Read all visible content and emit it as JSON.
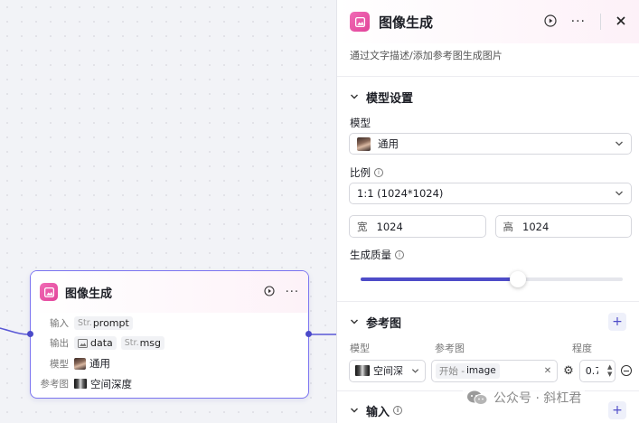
{
  "node": {
    "title": "图像生成",
    "rows": [
      {
        "label": "输入",
        "tags": [
          {
            "prefix": "Str.",
            "text": "prompt"
          }
        ]
      },
      {
        "label": "输出",
        "tags": [
          {
            "prefix": "",
            "text": "data",
            "icon": "image-icon"
          },
          {
            "prefix": "Str.",
            "text": "msg"
          }
        ]
      },
      {
        "label": "模型",
        "value": "通用"
      },
      {
        "label": "参考图",
        "value": "空间深度"
      }
    ]
  },
  "panel": {
    "title": "图像生成",
    "description": "通过文字描述/添加参考图生成图片",
    "model_section": {
      "title": "模型设置",
      "model_label": "模型",
      "model_value": "通用",
      "ratio_label": "比例",
      "ratio_value": "1:1 (1024*1024)",
      "width_label": "宽",
      "width_value": "1024",
      "height_label": "高",
      "height_value": "1024",
      "quality_label": "生成质量",
      "quality_fraction": 0.6
    },
    "reference_section": {
      "title": "参考图",
      "col_model": "模型",
      "col_ref": "参考图",
      "col_degree": "程度",
      "model_value": "空间深",
      "chip_prefix": "开始 -",
      "chip_value": "image",
      "degree_value": "0.7"
    },
    "input_section": {
      "title": "输入"
    }
  },
  "watermark": "公众号 · 斜杠君",
  "colors": {
    "accent": "#4e4cc8",
    "node_border": "#7b74f0",
    "app_icon": "#e2449a"
  }
}
